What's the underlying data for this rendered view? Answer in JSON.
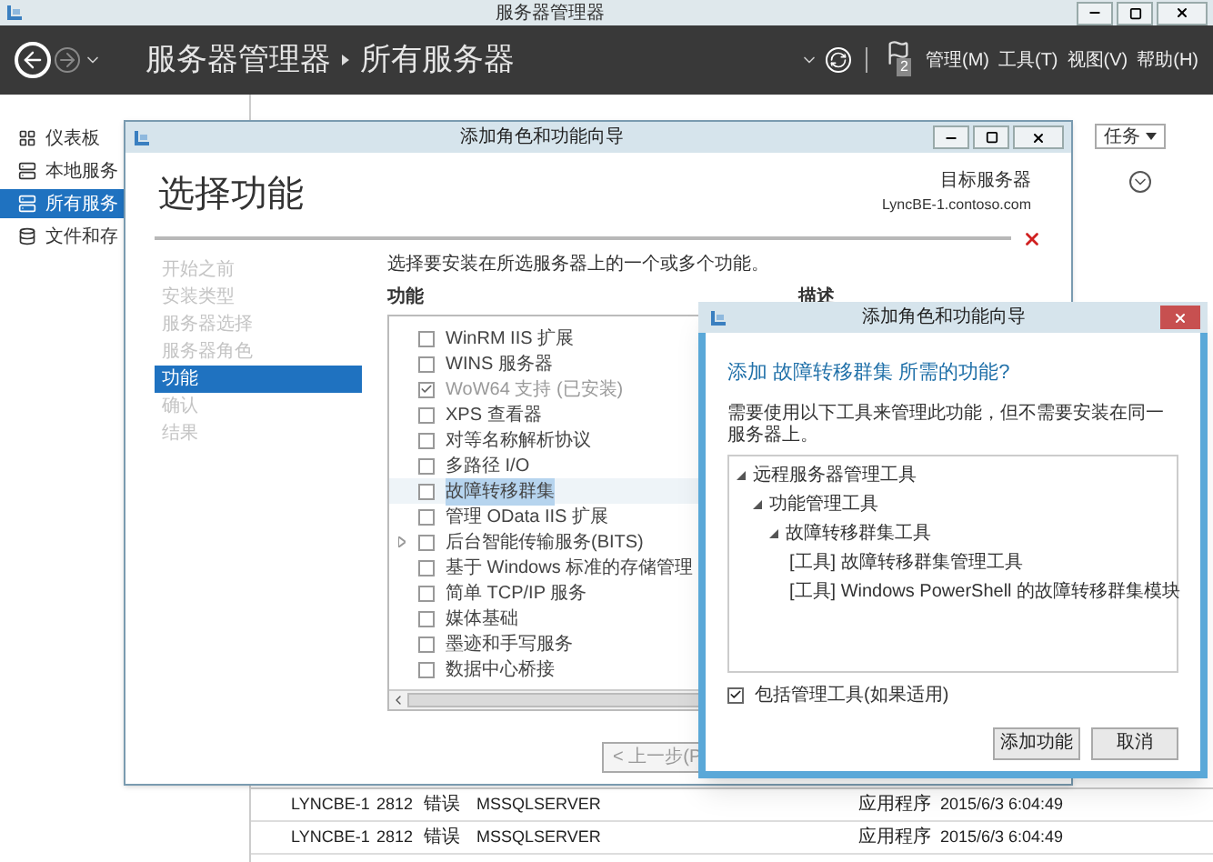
{
  "window": {
    "title": "服务器管理器"
  },
  "header": {
    "breadcrumb": [
      "服务器管理器",
      "所有服务器"
    ],
    "notification_count": "2",
    "menus": [
      "管理(M)",
      "工具(T)",
      "视图(V)",
      "帮助(H)"
    ]
  },
  "sidebar": {
    "items": [
      {
        "label": "仪表板",
        "selected": false
      },
      {
        "label": "本地服务",
        "selected": false
      },
      {
        "label": "所有服务",
        "selected": true
      },
      {
        "label": "文件和存",
        "selected": false
      }
    ]
  },
  "main": {
    "tasks_button": "任务",
    "events": [
      {
        "server": "LYNCBE-1",
        "id": "2812",
        "severity": "错误",
        "source": "MSSQLSERVER",
        "log": "应用程序",
        "time": "2015/6/3 6:04:49"
      },
      {
        "server": "LYNCBE-1",
        "id": "2812",
        "severity": "错误",
        "source": "MSSQLSERVER",
        "log": "应用程序",
        "time": "2015/6/3 6:04:49"
      }
    ]
  },
  "wizard": {
    "title": "添加角色和功能向导",
    "page_title": "选择功能",
    "target_label": "目标服务器",
    "target_server": "LyncBE-1.contoso.com",
    "steps": [
      {
        "label": "开始之前",
        "selected": false
      },
      {
        "label": "安装类型",
        "selected": false
      },
      {
        "label": "服务器选择",
        "selected": false
      },
      {
        "label": "服务器角色",
        "selected": false
      },
      {
        "label": "功能",
        "selected": true
      },
      {
        "label": "确认",
        "selected": false
      },
      {
        "label": "结果",
        "selected": false
      }
    ],
    "instruction": "选择要安装在所选服务器上的一个或多个功能。",
    "features_header": "功能",
    "description_header": "描述",
    "features": [
      {
        "label": "WinRM IIS 扩展",
        "checked": false,
        "disabled": false,
        "selected": false,
        "expandable": false
      },
      {
        "label": "WINS 服务器",
        "checked": false,
        "disabled": false,
        "selected": false,
        "expandable": false
      },
      {
        "label": "WoW64 支持 (已安装)",
        "checked": true,
        "disabled": true,
        "selected": false,
        "expandable": false
      },
      {
        "label": "XPS 查看器",
        "checked": false,
        "disabled": false,
        "selected": false,
        "expandable": false
      },
      {
        "label": "对等名称解析协议",
        "checked": false,
        "disabled": false,
        "selected": false,
        "expandable": false
      },
      {
        "label": "多路径 I/O",
        "checked": false,
        "disabled": false,
        "selected": false,
        "expandable": false
      },
      {
        "label": "故障转移群集",
        "checked": false,
        "disabled": false,
        "selected": true,
        "expandable": false
      },
      {
        "label": "管理 OData IIS 扩展",
        "checked": false,
        "disabled": false,
        "selected": false,
        "expandable": false
      },
      {
        "label": "后台智能传输服务(BITS)",
        "checked": false,
        "disabled": false,
        "selected": false,
        "expandable": true
      },
      {
        "label": "基于 Windows 标准的存储管理",
        "checked": false,
        "disabled": false,
        "selected": false,
        "expandable": false
      },
      {
        "label": "简单 TCP/IP 服务",
        "checked": false,
        "disabled": false,
        "selected": false,
        "expandable": false
      },
      {
        "label": "媒体基础",
        "checked": false,
        "disabled": false,
        "selected": false,
        "expandable": false
      },
      {
        "label": "墨迹和手写服务",
        "checked": false,
        "disabled": false,
        "selected": false,
        "expandable": false
      },
      {
        "label": "数据中心桥接",
        "checked": false,
        "disabled": false,
        "selected": false,
        "expandable": false
      }
    ],
    "back_button": "< 上一步(P"
  },
  "dialog": {
    "title": "添加角色和功能向导",
    "heading": "添加 故障转移群集 所需的功能?",
    "message": "需要使用以下工具来管理此功能，但不需要安装在同一服务器上。",
    "tree": [
      {
        "label": "远程服务器管理工具",
        "children": [
          {
            "label": "功能管理工具",
            "children": [
              {
                "label": "故障转移群集工具",
                "children": [
                  {
                    "label": "[工具] 故障转移群集管理工具"
                  },
                  {
                    "label": "[工具] Windows PowerShell 的故障转移群集模块"
                  }
                ]
              }
            ]
          }
        ]
      }
    ],
    "include_tools": {
      "label": "包括管理工具(如果适用)",
      "checked": true
    },
    "buttons": [
      "添加功能",
      "取消"
    ]
  }
}
